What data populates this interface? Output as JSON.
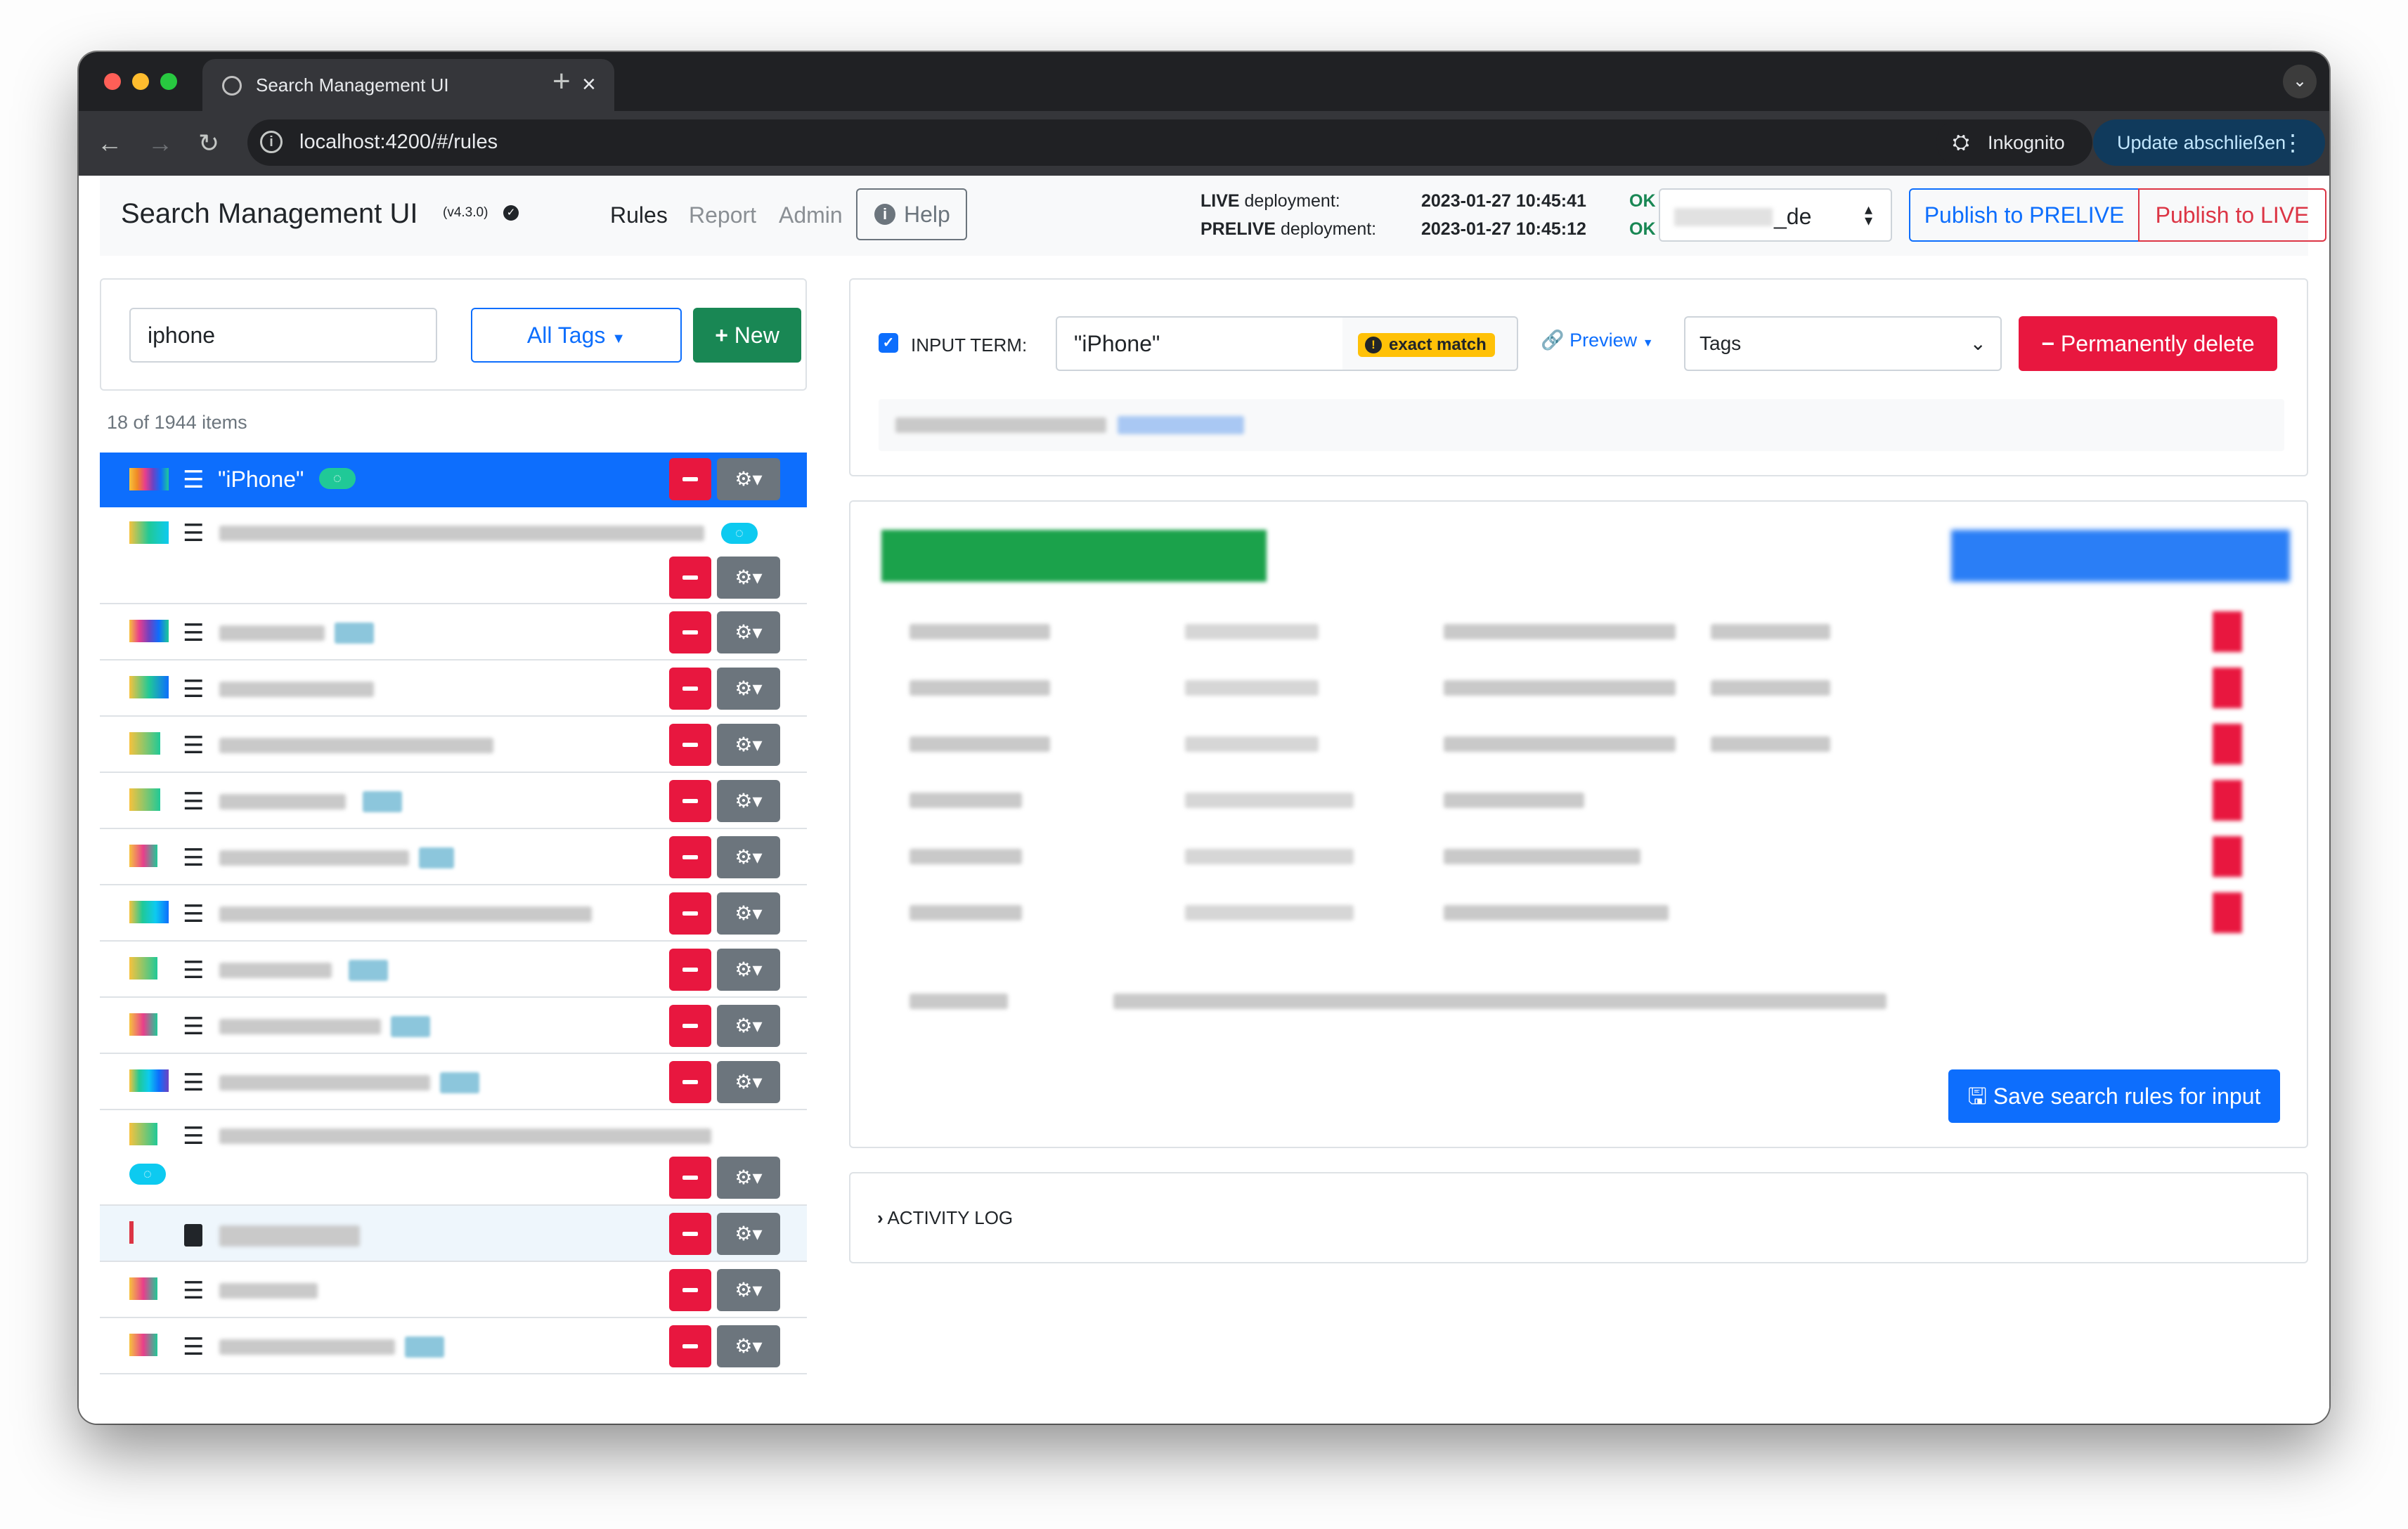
{
  "browser": {
    "tab_title": "Search Management UI",
    "tab_close": "×",
    "new_tab": "+",
    "url": "localhost:4200/#/rules",
    "incognito_label": "Inkognito",
    "update_label": "Update abschließen"
  },
  "navbar": {
    "brand": "Search Management UI",
    "version": "(v4.3.0)",
    "links": [
      "Rules",
      "Report",
      "Admin"
    ],
    "help_label": "Help",
    "live_label": "LIVE",
    "live_text": "deployment:",
    "live_date": "2023-01-27 10:45:41",
    "live_status": "OK",
    "prelive_label": "PRELIVE",
    "prelive_text": "deployment:",
    "prelive_date": "2023-01-27 10:45:12",
    "prelive_status": "OK",
    "tenant_suffix": "_de",
    "publish_prelive": "Publish to PRELIVE",
    "publish_live": "Publish to LIVE"
  },
  "sidebar": {
    "search_value": "iphone",
    "tags_label": "All Tags",
    "new_label": "New",
    "count_text": "18 of 1944 items",
    "active_title": "\"iPhone\""
  },
  "editor": {
    "input_term_label": "INPUT TERM:",
    "term_value": "\"iPhone\"",
    "match_badge": "exact match",
    "preview_label": "Preview",
    "tags_placeholder": "Tags",
    "delete_label": "Permanently delete",
    "save_label": "Save search rules for input",
    "activity_label": "ACTIVITY LOG"
  },
  "colors": {
    "primary": "#0d6efd",
    "danger": "#e8173f",
    "success": "#198754",
    "secondary": "#6c757d"
  }
}
